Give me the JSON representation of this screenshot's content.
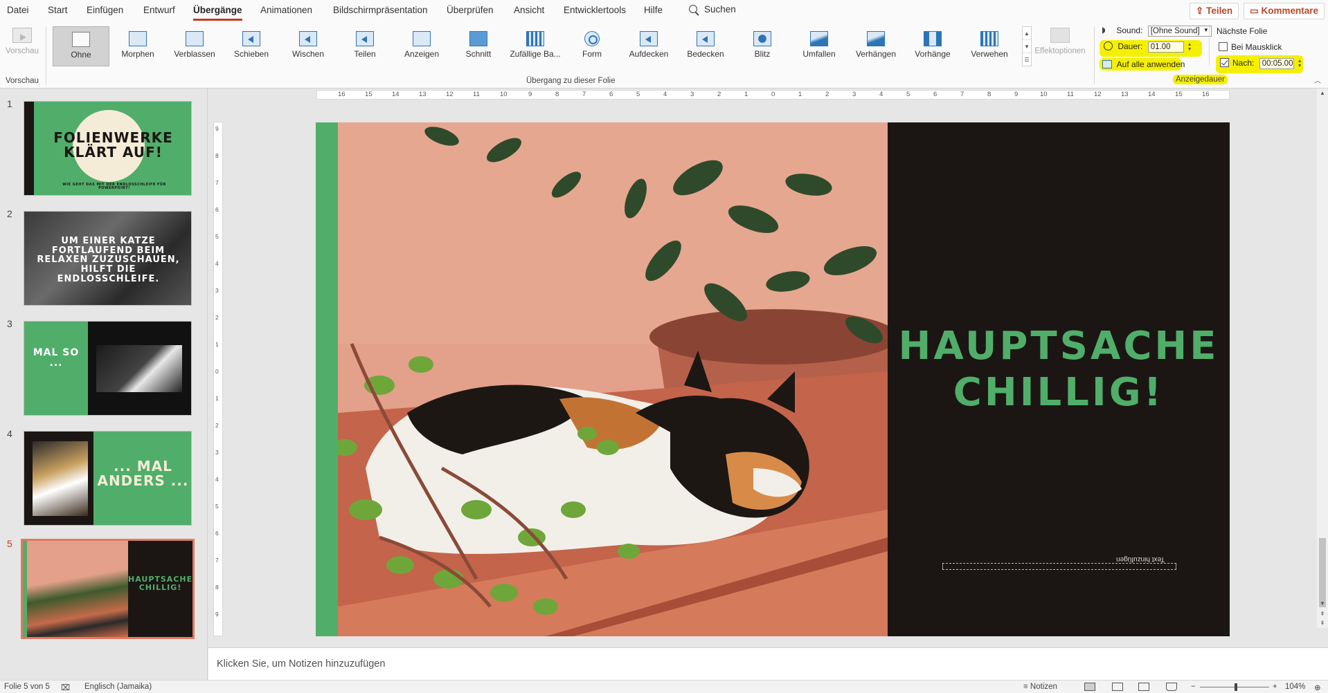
{
  "menu": {
    "items": [
      "Datei",
      "Start",
      "Einfügen",
      "Entwurf",
      "Übergänge",
      "Animationen",
      "Bildschirmpräsentation",
      "Überprüfen",
      "Ansicht",
      "Entwicklertools",
      "Hilfe"
    ],
    "search": "Suchen",
    "share": "Teilen",
    "comments": "Kommentare"
  },
  "ribbon": {
    "preview_label": "Vorschau",
    "preview_group": "Vorschau",
    "transitions": [
      "Ohne",
      "Morphen",
      "Verblassen",
      "Schieben",
      "Wischen",
      "Teilen",
      "Anzeigen",
      "Schnitt",
      "Zufällige Ba...",
      "Form",
      "Aufdecken",
      "Bedecken",
      "Blitz",
      "Umfallen",
      "Verhängen",
      "Vorhänge",
      "Verwehen"
    ],
    "transition_group": "Übergang zu dieser Folie",
    "effect_options": "Effektoptionen",
    "timing": {
      "sound_label": "Sound:",
      "sound_value": "[Ohne Sound]",
      "duration_label": "Dauer:",
      "duration_value": "01.00",
      "apply_all": "Auf alle anwenden",
      "next_slide_label": "Nächste Folie",
      "on_click_label": "Bei Mausklick",
      "after_label": "Nach:",
      "after_value": "00:05.00",
      "group": "Anzeigedauer"
    }
  },
  "thumbnails": [
    {
      "num": "1",
      "title": "FOLIENWERKE KLÄRT AUF!",
      "subtitle": "WIE GEHT DAS MIT DER ENDLOSSCHLEIFE FÜR POWERPOINT!"
    },
    {
      "num": "2",
      "title": "UM EINER KATZE FORTLAUFEND BEIM RELAXEN ZUZUSCHAUEN, HILFT DIE ENDLOSSCHLEIFE."
    },
    {
      "num": "3",
      "title": "MAL SO ..."
    },
    {
      "num": "4",
      "title": "... MAL ANDERS ..."
    },
    {
      "num": "5",
      "title": "HAUPTSACHE CHILLIG!"
    }
  ],
  "ruler": {
    "h": [
      "16",
      "15",
      "14",
      "13",
      "12",
      "11",
      "10",
      "9",
      "8",
      "7",
      "6",
      "5",
      "4",
      "3",
      "2",
      "1",
      "0",
      "1",
      "2",
      "3",
      "4",
      "5",
      "6",
      "7",
      "8",
      "9",
      "10",
      "11",
      "12",
      "13",
      "14",
      "15",
      "16"
    ],
    "v": [
      "9",
      "8",
      "7",
      "6",
      "5",
      "4",
      "3",
      "2",
      "1",
      "0",
      "1",
      "2",
      "3",
      "4",
      "5",
      "6",
      "7",
      "8",
      "9"
    ]
  },
  "slide": {
    "title": "HAUPTSACHE CHILLIG!",
    "placeholder": "Text hinzufügen"
  },
  "notes_placeholder": "Klicken Sie, um Notizen hinzuzufügen",
  "status": {
    "slide_info": "Folie 5 von 5",
    "language": "Englisch (Jamaika)",
    "notes": "Notizen",
    "zoom": "104%"
  },
  "colors": {
    "accent_green": "#50ae6a",
    "slide_dark": "#1b1614",
    "highlight": "#f5f000",
    "office_red": "#c43e1c"
  }
}
